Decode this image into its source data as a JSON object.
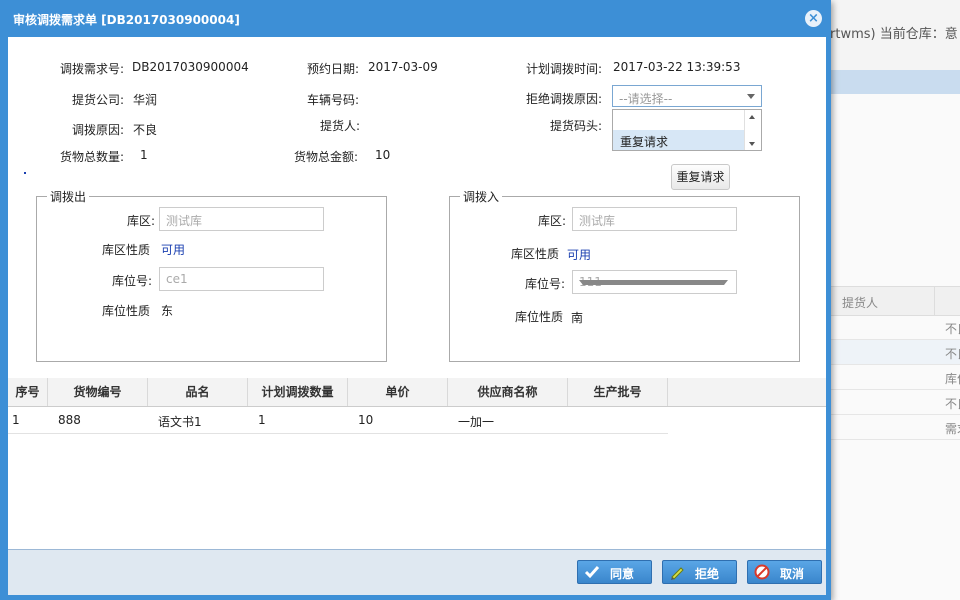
{
  "background": {
    "header_text": "rtwms) 当前仓库：意",
    "table_header": "提货人",
    "rows": [
      "不良",
      "不良",
      "库位",
      "不良",
      "需求"
    ]
  },
  "dialog": {
    "title": "审核调拨需求单 [DB2017030900004]",
    "close_icon": "×",
    "fields": {
      "demand_no_label": "调拨需求号:",
      "demand_no": "DB2017030900004",
      "appoint_date_label": "预约日期:",
      "appoint_date": "2017-03-09",
      "plan_time_label": "计划调拨时间:",
      "plan_time": "2017-03-22 13:39:53",
      "company_label": "提货公司:",
      "company": "华润",
      "vehicle_label": "车辆号码:",
      "vehicle": "",
      "reject_reason_label": "拒绝调拨原因:",
      "reject_reason_placeholder": "--请选择--",
      "reason_label": "调拨原因:",
      "reason": "不良",
      "picker_label": "提货人:",
      "picker": "",
      "dock_label": "提货码头:",
      "dock": "",
      "total_qty_label": "货物总数量:",
      "total_qty": "1",
      "total_amount_label": "货物总金额:",
      "total_amount": "10"
    },
    "dropdown": {
      "options": [
        "",
        "重复请求"
      ],
      "tooltip": "重复请求"
    },
    "transfer_out": {
      "legend": "调拨出",
      "area_label": "库区:",
      "area": "测试库",
      "area_nature_label": "库区性质",
      "area_nature": "可用",
      "location_label": "库位号:",
      "location": "ce1",
      "location_nature_label": "库位性质",
      "location_nature": "东"
    },
    "transfer_in": {
      "legend": "调拨入",
      "area_label": "库区:",
      "area": "测试库",
      "area_nature_label": "库区性质",
      "area_nature": "可用",
      "location_label": "库位号:",
      "location": "111",
      "location_nature_label": "库位性质",
      "location_nature": "南"
    },
    "grid": {
      "columns": [
        "序号",
        "货物编号",
        "品名",
        "计划调拨数量",
        "单价",
        "供应商名称",
        "生产批号"
      ],
      "rows": [
        [
          "1",
          "888",
          "语文书1",
          "1",
          "10",
          "一加一",
          ""
        ]
      ]
    },
    "buttons": {
      "agree": "同意",
      "reject": "拒绝",
      "cancel": "取消"
    }
  },
  "colors": {
    "dialog_blue": "#3d8fd6",
    "link_blue": "#1a3fb0"
  }
}
